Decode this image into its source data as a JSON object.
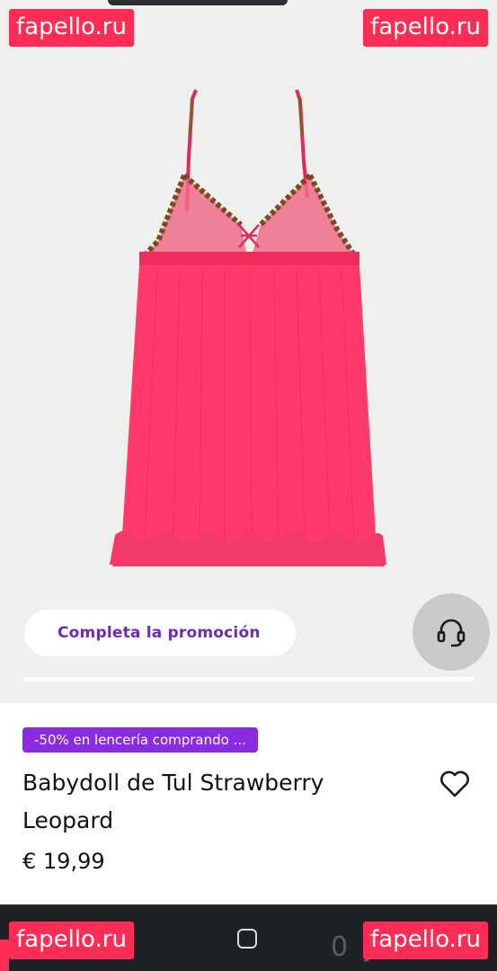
{
  "watermark": {
    "text": "fapello.ru",
    "color": "#ff2d55"
  },
  "product": {
    "image_alt": "Babydoll de Tul Strawberry Leopard",
    "color": "#ff3a6a",
    "promo_pill_label": "Completa la promoción",
    "badge": "-50% en lencería comprando ...",
    "title": "Babydoll de Tul Strawberry Leopard",
    "price": "€ 19,99"
  },
  "icons": {
    "support": "headset-icon",
    "favorite": "heart-icon",
    "home": "square-home-icon"
  },
  "nav": {
    "faint_text": "0  y  5  C"
  }
}
